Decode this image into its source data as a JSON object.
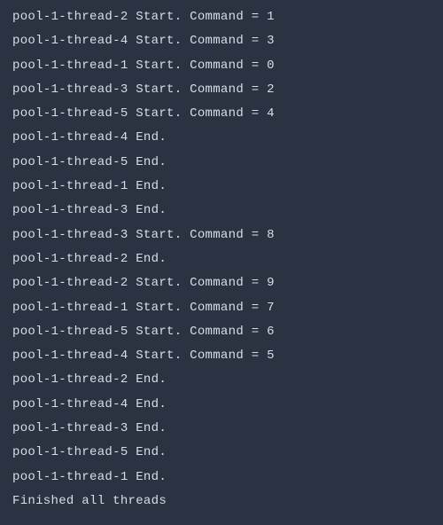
{
  "console": {
    "lines": [
      "pool-1-thread-2 Start. Command = 1",
      "pool-1-thread-4 Start. Command = 3",
      "pool-1-thread-1 Start. Command = 0",
      "pool-1-thread-3 Start. Command = 2",
      "pool-1-thread-5 Start. Command = 4",
      "pool-1-thread-4 End.",
      "pool-1-thread-5 End.",
      "pool-1-thread-1 End.",
      "pool-1-thread-3 End.",
      "pool-1-thread-3 Start. Command = 8",
      "pool-1-thread-2 End.",
      "pool-1-thread-2 Start. Command = 9",
      "pool-1-thread-1 Start. Command = 7",
      "pool-1-thread-5 Start. Command = 6",
      "pool-1-thread-4 Start. Command = 5",
      "pool-1-thread-2 End.",
      "pool-1-thread-4 End.",
      "pool-1-thread-3 End.",
      "pool-1-thread-5 End.",
      "pool-1-thread-1 End.",
      "Finished all threads"
    ]
  }
}
